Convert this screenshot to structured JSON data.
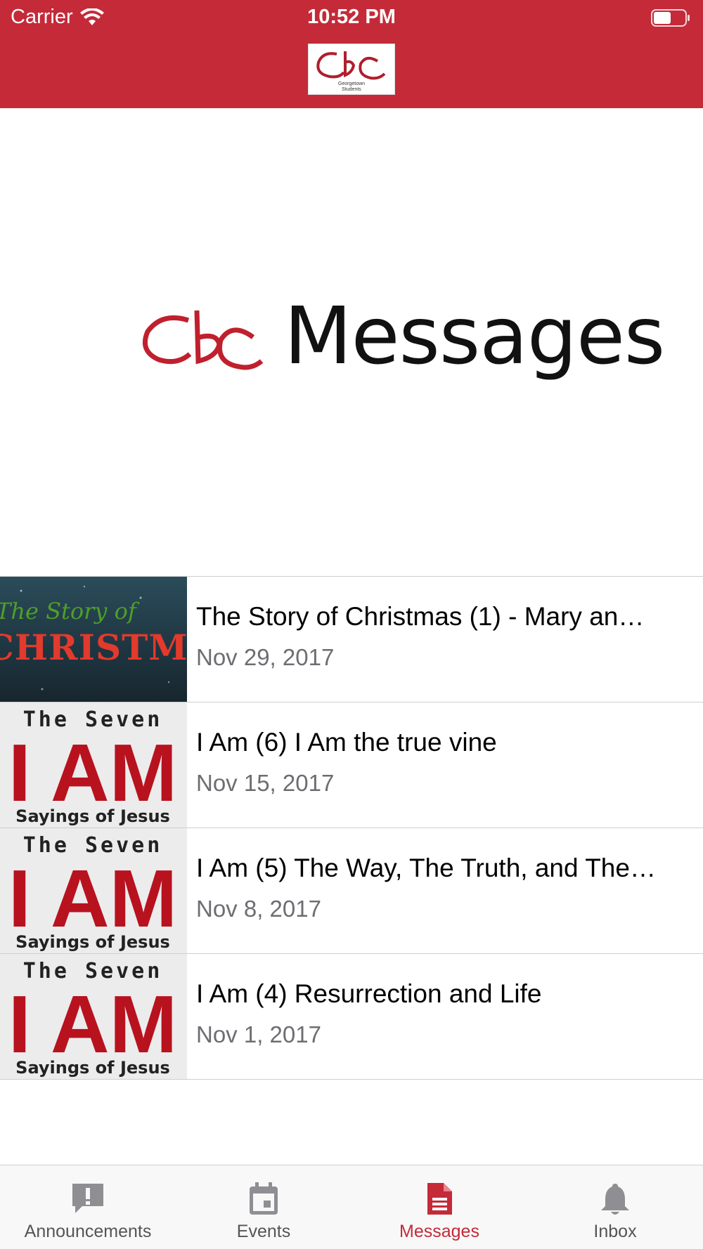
{
  "status_bar": {
    "carrier": "Carrier",
    "time": "10:52 PM"
  },
  "header": {
    "logo_text": "Georgetown Students"
  },
  "banner": {
    "title": "Messages",
    "logo": "GBC"
  },
  "messages": [
    {
      "title": "The Story of Christmas (1) - Mary an…",
      "date": "Nov 29, 2017",
      "thumb": {
        "line1": "The Story of",
        "line2": "CHRISTMAS"
      }
    },
    {
      "title": "I Am (6) I Am the true vine",
      "date": "Nov 15, 2017",
      "thumb": {
        "line1": "The Seven",
        "line2": "I AM",
        "line3": "Sayings of Jesus"
      }
    },
    {
      "title": "I Am (5) The Way, The Truth, and The…",
      "date": "Nov 8, 2017",
      "thumb": {
        "line1": "The Seven",
        "line2": "I AM",
        "line3": "Sayings of Jesus"
      }
    },
    {
      "title": "I Am (4) Resurrection and Life",
      "date": "Nov 1, 2017",
      "thumb": {
        "line1": "The Seven",
        "line2": "I AM",
        "line3": "Sayings of Jesus"
      }
    }
  ],
  "tabs": [
    {
      "label": "Announcements",
      "icon": "exclamation-icon"
    },
    {
      "label": "Events",
      "icon": "calendar-icon"
    },
    {
      "label": "Messages",
      "icon": "document-icon"
    },
    {
      "label": "Inbox",
      "icon": "bell-icon"
    }
  ],
  "colors": {
    "brand_red": "#c42a38",
    "date_gray": "#6d6d72",
    "tab_inactive": "#555555"
  }
}
